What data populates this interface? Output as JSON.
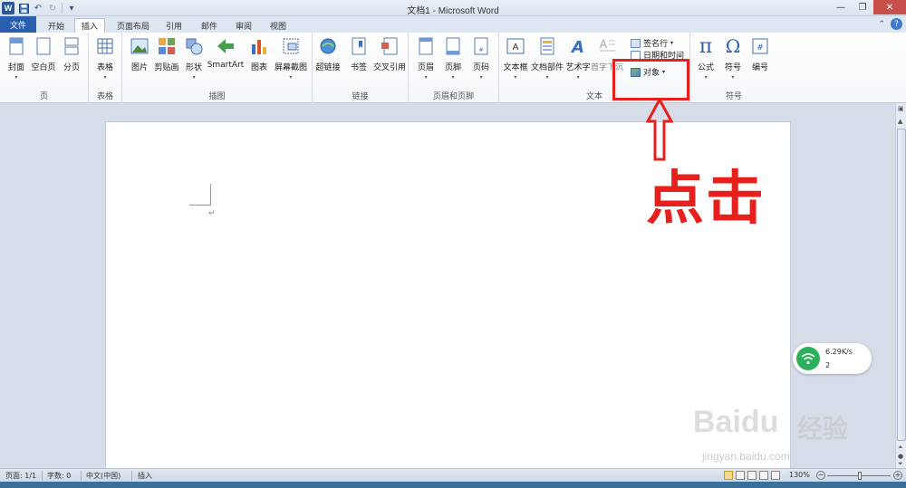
{
  "window": {
    "title": "文档1 - Microsoft Word"
  },
  "qat": {
    "logo": "W"
  },
  "tabs": {
    "file": "文件",
    "items": [
      "开始",
      "插入",
      "页面布局",
      "引用",
      "邮件",
      "审阅",
      "视图"
    ],
    "active": "插入"
  },
  "ribbon": {
    "groups": {
      "pages": {
        "label": "页",
        "buttons": [
          "封面",
          "空白页",
          "分页"
        ]
      },
      "tables": {
        "label": "表格",
        "buttons": [
          "表格"
        ]
      },
      "illustrations": {
        "label": "插图",
        "buttons": [
          "图片",
          "剪贴画",
          "形状",
          "SmartArt",
          "图表",
          "屏幕截图"
        ]
      },
      "links": {
        "label": "链接",
        "buttons": [
          "超链接",
          "书签",
          "交叉引用"
        ]
      },
      "header_footer": {
        "label": "页眉和页脚",
        "buttons": [
          "页眉",
          "页脚",
          "页码"
        ]
      },
      "text": {
        "label": "文本",
        "buttons": [
          "文本框",
          "文档部件",
          "艺术字",
          "首字下沉"
        ],
        "small_buttons": [
          "签名行",
          "日期和时间",
          "对象"
        ]
      },
      "symbols": {
        "label": "符号",
        "buttons": [
          "公式",
          "符号",
          "编号"
        ]
      }
    }
  },
  "annotation": {
    "text": "点击",
    "color": "#e8201d"
  },
  "network_widget": {
    "speed": "6.29K/s",
    "count": "2"
  },
  "watermark": {
    "brand": "Baidu",
    "cn": "经验",
    "url": "jingyan.baidu.com"
  },
  "statusbar": {
    "page": "页面: 1/1",
    "words": "字数: 0",
    "language": "中文(中国)",
    "mode": "插入",
    "zoom": "130%"
  },
  "colors": {
    "accent": "#2a5fb0",
    "highlight": "#e8201d",
    "wifi": "#2eb05a"
  }
}
